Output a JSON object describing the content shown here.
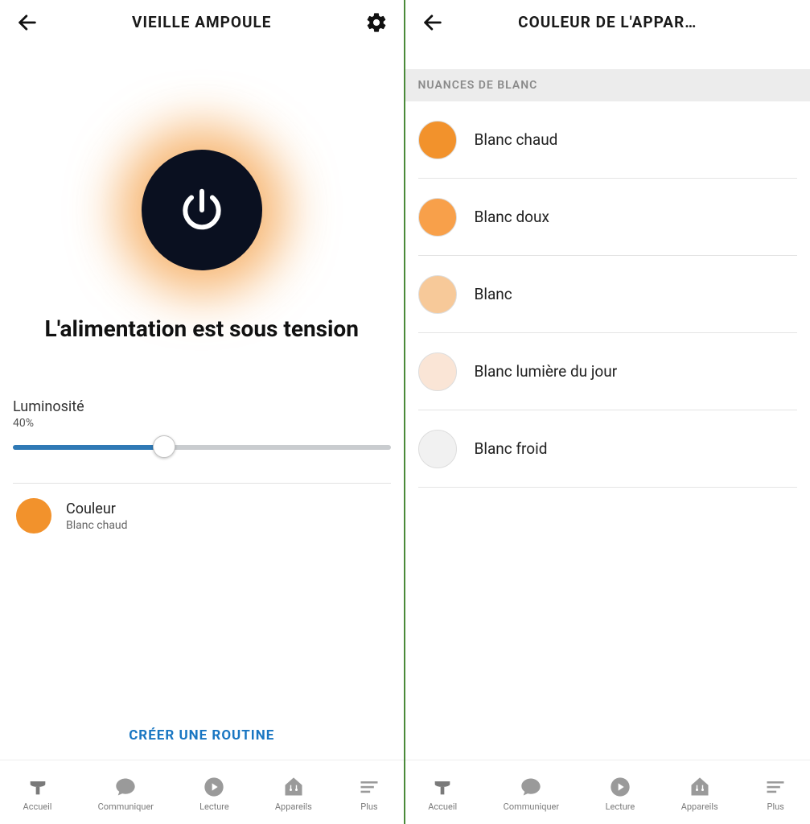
{
  "left": {
    "header": {
      "title": "VIEILLE AMPOULE"
    },
    "status": "L'alimentation est sous tension",
    "brightness": {
      "label": "Luminosité",
      "value": "40%",
      "percent": 40
    },
    "color": {
      "label": "Couleur",
      "value": "Blanc chaud",
      "swatch": "#f2922c"
    },
    "routine_link": "CRÉER UNE ROUTINE"
  },
  "right": {
    "header": {
      "title": "COULEUR DE L'APPAR…"
    },
    "section_title": "NUANCES DE BLANC",
    "options": [
      {
        "label": "Blanc chaud",
        "color": "#f2922c"
      },
      {
        "label": "Blanc doux",
        "color": "#f8a04a"
      },
      {
        "label": "Blanc",
        "color": "#f7c999"
      },
      {
        "label": "Blanc lumière du jour",
        "color": "#fae5d6"
      },
      {
        "label": "Blanc froid",
        "color": "#f1f1f1"
      }
    ]
  },
  "tabs": [
    {
      "label": "Accueil"
    },
    {
      "label": "Communiquer"
    },
    {
      "label": "Lecture"
    },
    {
      "label": "Appareils"
    },
    {
      "label": "Plus"
    }
  ]
}
